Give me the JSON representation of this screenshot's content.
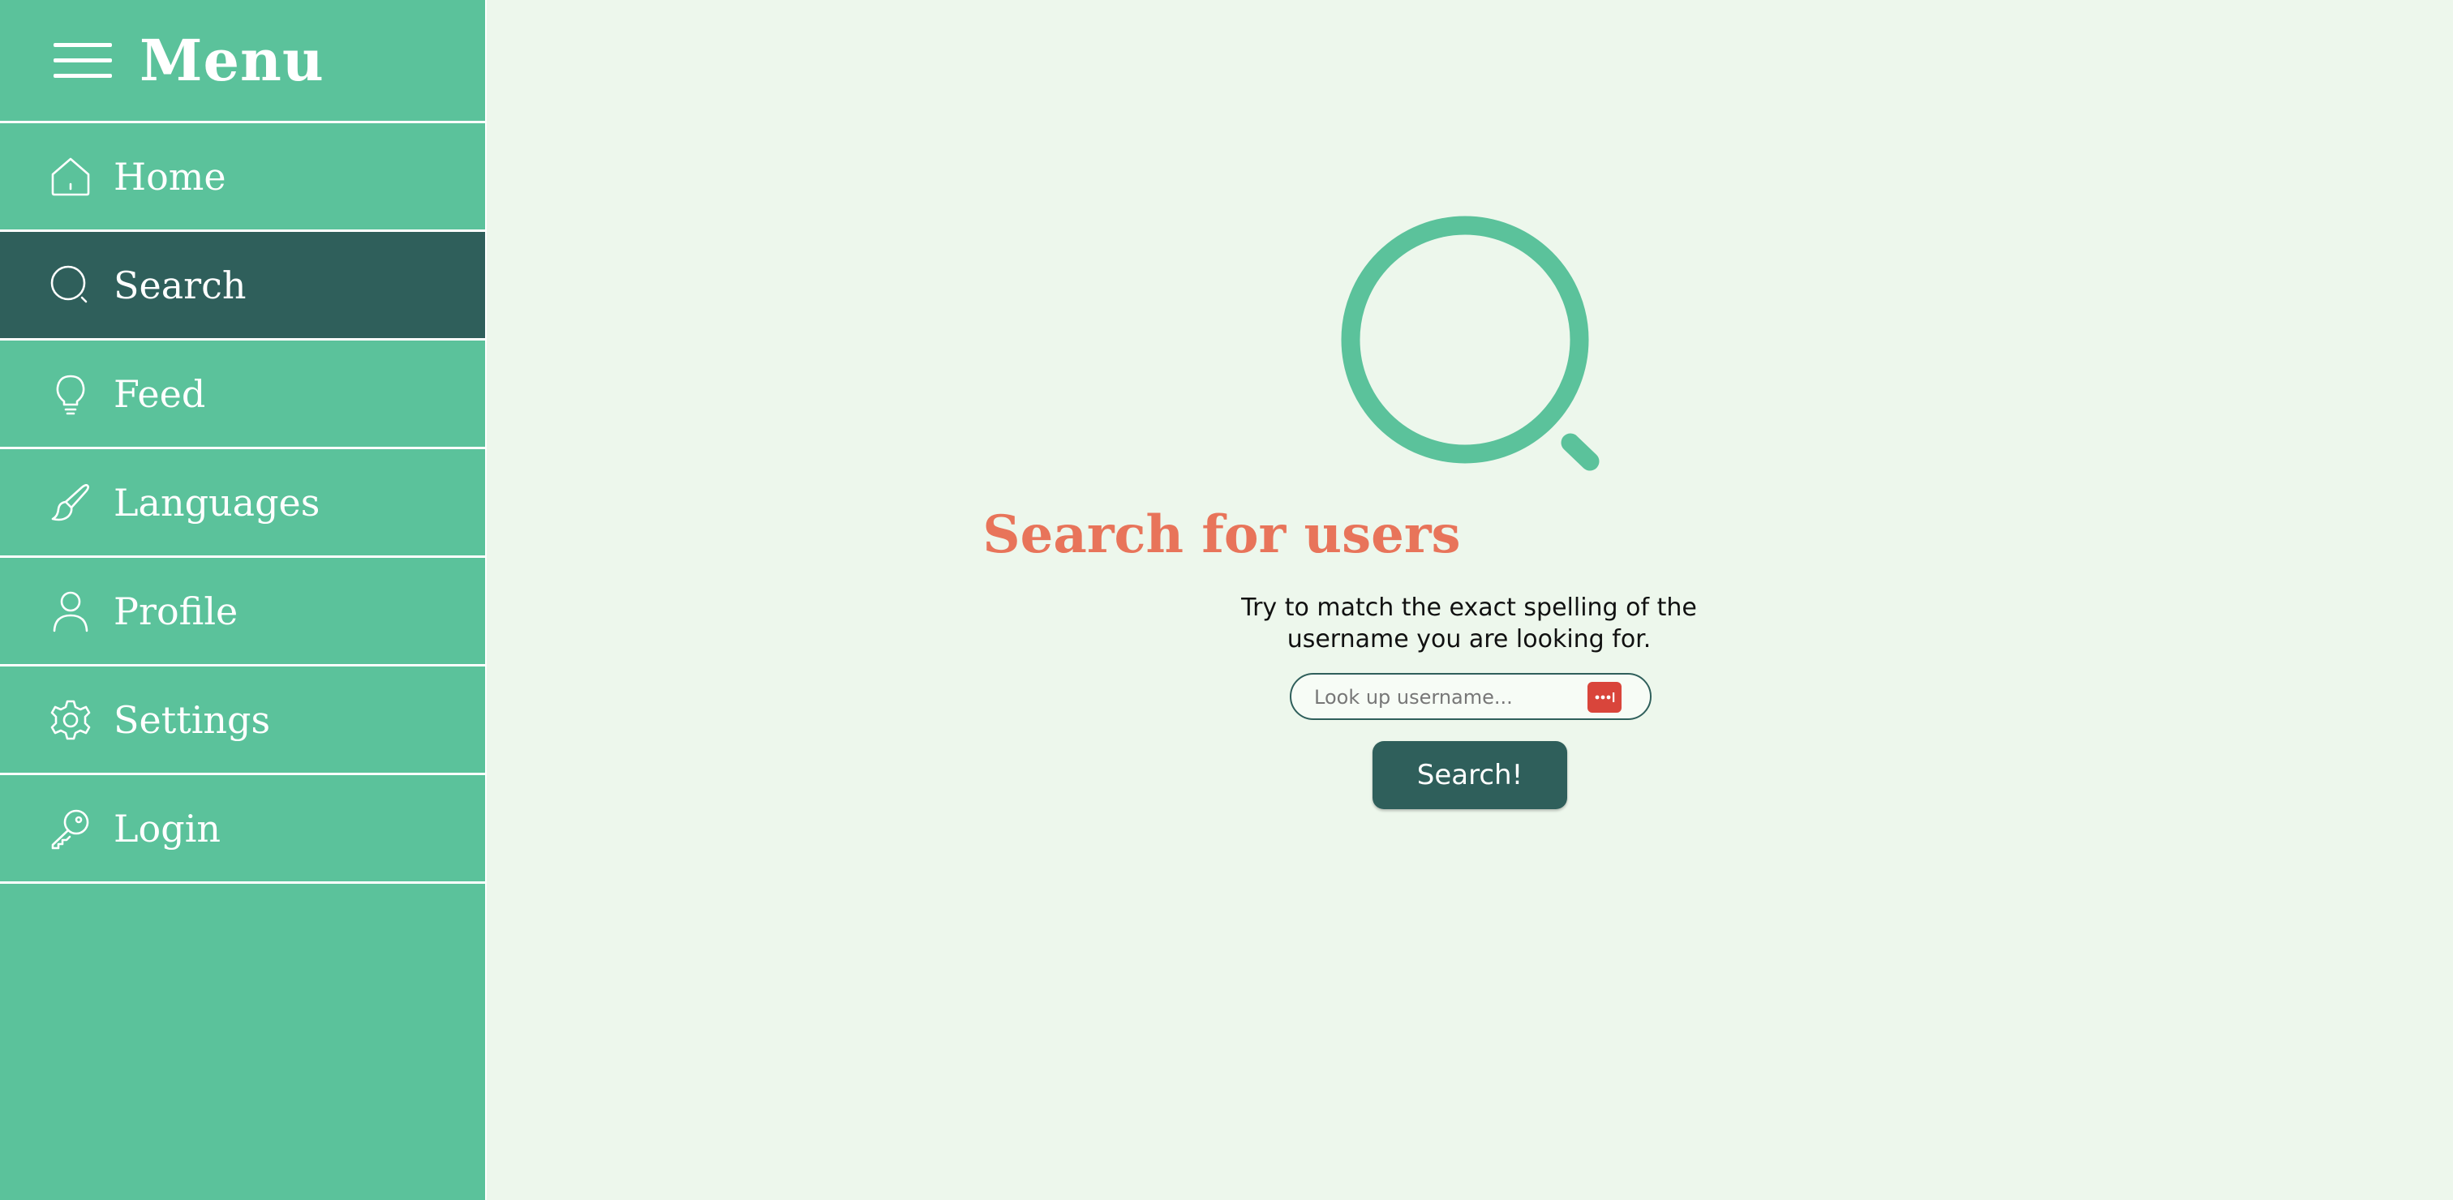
{
  "sidebar": {
    "title": "Menu",
    "menu_icon": "hamburger-icon",
    "items": [
      {
        "label": "Home",
        "icon": "home-icon",
        "active": false
      },
      {
        "label": "Search",
        "icon": "search-icon",
        "active": true
      },
      {
        "label": "Feed",
        "icon": "lightbulb-icon",
        "active": false
      },
      {
        "label": "Languages",
        "icon": "brush-icon",
        "active": false
      },
      {
        "label": "Profile",
        "icon": "user-icon",
        "active": false
      },
      {
        "label": "Settings",
        "icon": "gear-icon",
        "active": false
      },
      {
        "label": "Login",
        "icon": "key-icon",
        "active": false
      }
    ]
  },
  "main": {
    "hero_icon": "search-icon",
    "heading": "Search for users",
    "description": "Try to match the exact spelling of the username you are looking for.",
    "search_input": {
      "placeholder": "Look up username...",
      "value": ""
    },
    "search_button": "Search!"
  },
  "colors": {
    "sidebar": "#5bc29b",
    "active_item": "#2f5f5b",
    "background": "#edf7ec",
    "heading": "#e8745a",
    "button": "#2f5f5b",
    "password_badge": "#d9453b"
  }
}
